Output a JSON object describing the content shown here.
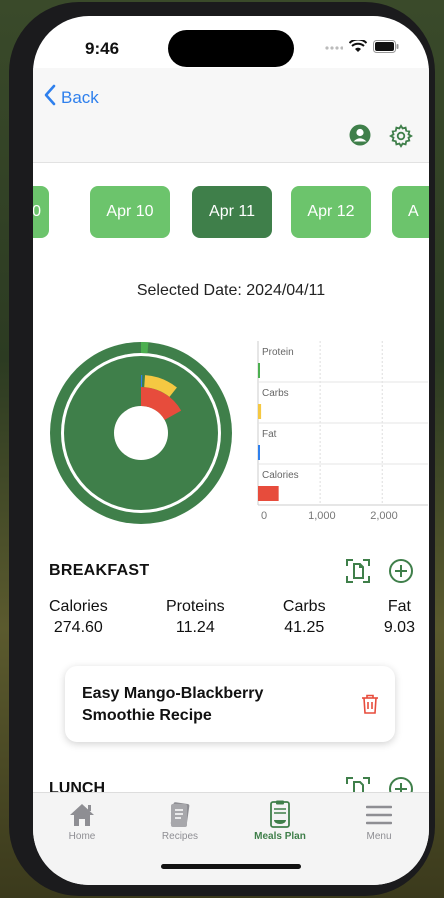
{
  "status_bar": {
    "time": "9:46"
  },
  "nav": {
    "back_label": "Back"
  },
  "dates": {
    "items": [
      {
        "label": "0",
        "state": "partial"
      },
      {
        "label": "Apr 10",
        "state": "normal"
      },
      {
        "label": "Apr 11",
        "state": "selected"
      },
      {
        "label": "Apr 12",
        "state": "normal"
      },
      {
        "label": "A",
        "state": "partial"
      }
    ]
  },
  "selected_date_text": "Selected Date: 2024/04/11",
  "chart_data": {
    "type": "bar",
    "categories": [
      "Protein",
      "Carbs",
      "Fat",
      "Calories"
    ],
    "values": [
      11.24,
      41.25,
      9.03,
      274.6
    ],
    "xlim": [
      0,
      2600
    ],
    "x_tick_labels": [
      "0",
      "1,000",
      "2,000"
    ],
    "colors": [
      "#4caf50",
      "#f5c842",
      "#2f80ed",
      "#e74c3c"
    ]
  },
  "breakfast": {
    "title": "BREAKFAST",
    "stats": [
      {
        "label": "Calories",
        "value": "274.60"
      },
      {
        "label": "Proteins",
        "value": "11.24"
      },
      {
        "label": "Carbs",
        "value": "41.25"
      },
      {
        "label": "Fat",
        "value": "9.03"
      }
    ],
    "recipe": "Easy Mango-Blackberry Smoothie Recipe"
  },
  "lunch": {
    "title": "LUNCH"
  },
  "tabs": [
    {
      "label": "Home",
      "icon": "home-icon"
    },
    {
      "label": "Recipes",
      "icon": "recipes-icon"
    },
    {
      "label": "Meals Plan",
      "icon": "meals-plan-icon"
    },
    {
      "label": "Menu",
      "icon": "menu-icon"
    }
  ],
  "colors": {
    "accent": "#3f7f4a",
    "light_green": "#6cc46c",
    "link": "#2f80ed",
    "danger": "#e74c3c"
  }
}
